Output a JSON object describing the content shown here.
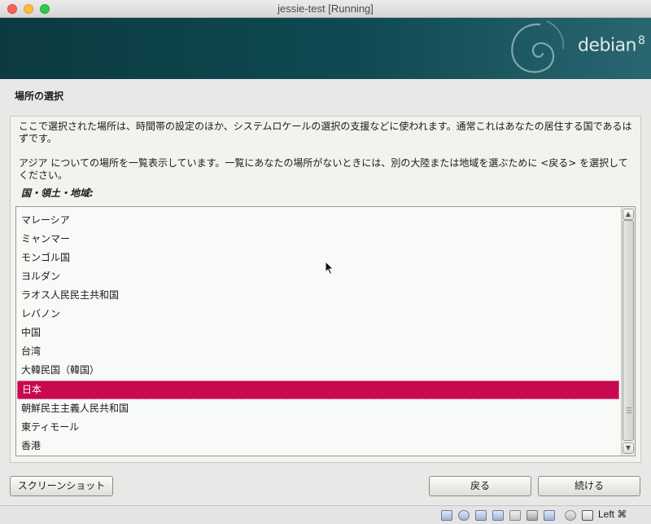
{
  "window": {
    "title": "jessie-test [Running]"
  },
  "banner": {
    "logo_text": "debian",
    "logo_version": "8"
  },
  "page": {
    "step_title": "場所の選択",
    "help_text_1": "ここで選択された場所は、時間帯の設定のほか、システムロケールの選択の支援などに使われます。通常これはあなたの居住する国であるはずです。",
    "help_text_2": "アジア についての場所を一覧表示しています。一覧にあなたの場所がないときには、別の大陸または地域を選ぶために <戻る> を選択してください。",
    "field_label": "国・領土・地域:"
  },
  "country_list": {
    "items": [
      "マレーシア",
      "ミャンマー",
      "モンゴル国",
      "ヨルダン",
      "ラオス人民民主共和国",
      "レバノン",
      "中国",
      "台湾",
      "大韓民国（韓国）",
      "日本",
      "朝鮮民主主義人民共和国",
      "東ティモール",
      "香港"
    ],
    "selected": "日本"
  },
  "buttons": {
    "screenshot": "スクリーンショット",
    "back": "戻る",
    "continue": "続ける"
  },
  "statusbar": {
    "host_key": "Left ⌘",
    "icons": [
      "hard-disk-icon",
      "optical-drive-icon",
      "usb-icon",
      "network-icon",
      "shared-folder-icon",
      "display-icon",
      "video-capture-icon",
      "cpu-icon",
      "mouse-integration-icon",
      "keyboard-capture-icon"
    ]
  },
  "colors": {
    "selection": "#c8094f",
    "banner": "#0f4a52"
  }
}
